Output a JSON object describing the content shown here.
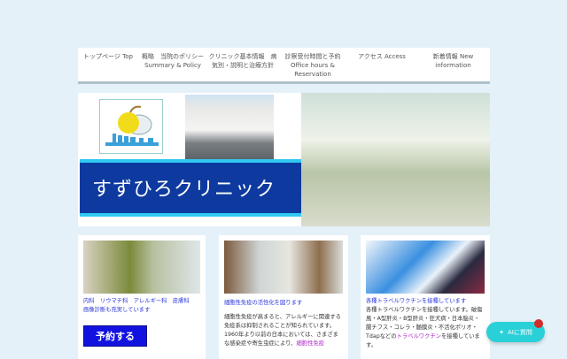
{
  "nav": [
    {
      "line1": "トップページ Top",
      "line2": "",
      "line3": ""
    },
    {
      "line1": "概略　当院のポリシー",
      "line2": "Summary & Policy",
      "line3": ""
    },
    {
      "line1": "クリニック基本情報　病",
      "line2": "気別・説明と治療方針",
      "line3": ""
    },
    {
      "line1": "診察受付時間と予約",
      "line2": "Office hours &",
      "line3": "Reservation"
    },
    {
      "line1": "アクセス Access",
      "line2": "",
      "line3": ""
    },
    {
      "line1": "新着情報 New",
      "line2": "information",
      "line3": ""
    }
  ],
  "banner": {
    "clinic_name": "すずひろクリニック"
  },
  "cards": [
    {
      "heading": "内科　リウマチ科　アレルギー科　皮膚科",
      "sub": "画像診断も充実しています",
      "button": "予約する"
    },
    {
      "heading": "細胞性免疫の活性化を図ります",
      "body": "細胞性免疫が高まると、アレルギーに関連する免疫系は抑制されることが知られています。1960年より以前の日本においては、さまざまな感染症や寄生虫症により、",
      "link": "細胞性免疫"
    },
    {
      "heading": "各種トラベルワクチンを接種しています",
      "body1": "各種トラベルワクチンを接種しています。破傷風・A型肝炎・B型肝炎・狂犬病・日本脳炎・腸チフス・コレラ・髄膜炎・不活化ポリオ・Tdapなどの",
      "link": "トラベルワクチン",
      "body2": "を接種しています。"
    }
  ],
  "ai_button": {
    "label": "AIに質問"
  }
}
